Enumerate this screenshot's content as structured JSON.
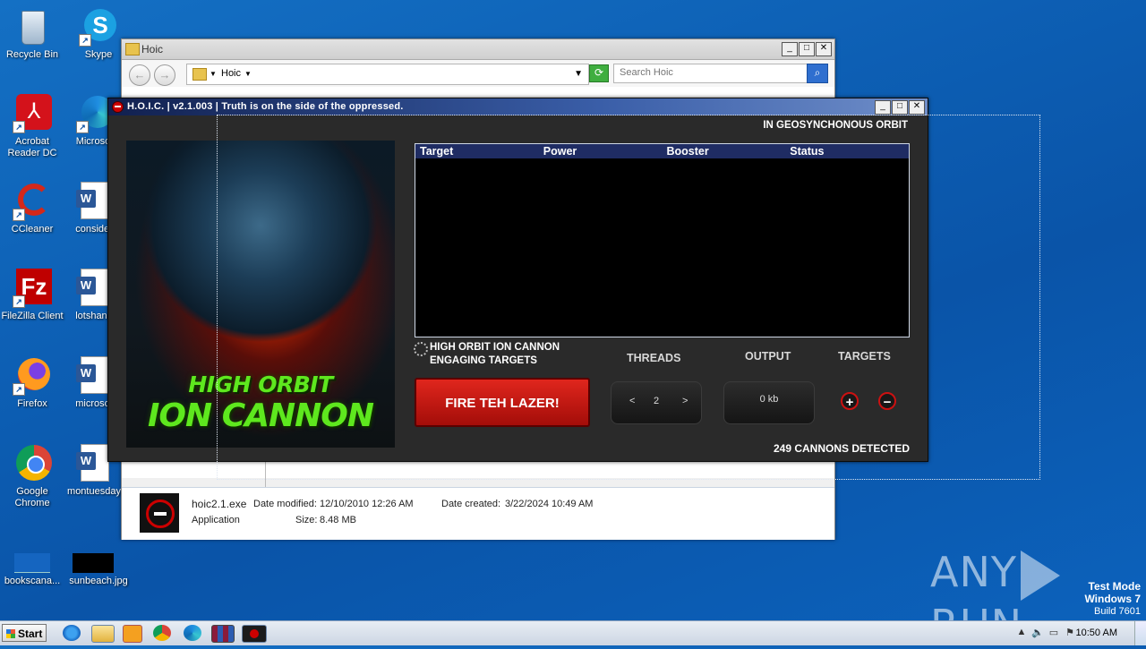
{
  "desktop": {
    "icons": [
      {
        "label": "Recycle Bin"
      },
      {
        "label": "Skype"
      },
      {
        "label": "Acrobat Reader DC"
      },
      {
        "label": "Microsoft"
      },
      {
        "label": "CCleaner"
      },
      {
        "label": "consider"
      },
      {
        "label": "FileZilla Client"
      },
      {
        "label": "lotshand"
      },
      {
        "label": "Firefox"
      },
      {
        "label": "microsof"
      },
      {
        "label": "Google Chrome"
      },
      {
        "label": "montuesday"
      },
      {
        "label": "bookscana..."
      },
      {
        "label": "sunbeach.jpg"
      }
    ]
  },
  "explorer": {
    "title": "Hoic",
    "address_crumb": "Hoic",
    "search_placeholder": "Search Hoic",
    "file": {
      "name": "hoic2.1.exe",
      "type": "Application",
      "date_modified_label": "Date modified:",
      "date_modified": "12/10/2010 12:26 AM",
      "date_created_label": "Date created:",
      "date_created": "3/22/2024 10:49 AM",
      "size_label": "Size:",
      "size": "8.48 MB"
    }
  },
  "hoic": {
    "title": "H.O.I.C. | v2.1.003 | Truth is on the side of the oppressed.",
    "orbit_status": "IN GEOSYNCHONOUS ORBIT",
    "poster_line1": "HIGH ORBIT",
    "poster_line2": "ION CANNON",
    "columns": [
      "Target",
      "Power",
      "Booster",
      "Status"
    ],
    "status_line1": "HIGH ORBIT ION CANNON",
    "status_line2": "ENGAGING TARGETS",
    "threads_label": "THREADS",
    "output_label": "OUTPUT",
    "targets_label": "TARGETS",
    "fire_label": "FIRE TEH LAZER!",
    "threads_value": "2",
    "threads_prev": "<",
    "threads_next": ">",
    "output_value": "0 kb",
    "add_target": "+",
    "remove_target": "−",
    "cannons_detected": "249 CANNONS DETECTED"
  },
  "watermark": {
    "brand": "ANY",
    "brand2": "RUN"
  },
  "testmode": {
    "line1": "Test Mode",
    "line2": "Windows 7",
    "line3": "Build 7601"
  },
  "taskbar": {
    "start_label": "Start",
    "clock": "10:50 AM"
  }
}
